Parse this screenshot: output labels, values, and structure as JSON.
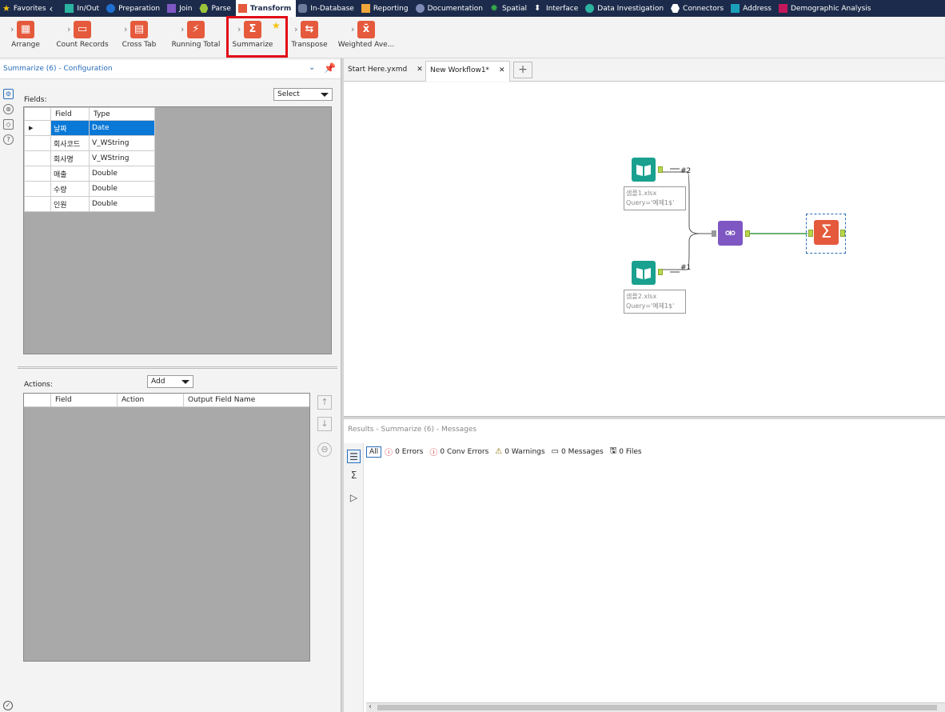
{
  "categories": [
    {
      "label": "Favorites",
      "icon": "star-icon",
      "color": "#f4c20d"
    },
    {
      "label": "In/Out",
      "icon": "folder-icon",
      "color": "#2bb3a0"
    },
    {
      "label": "Preparation",
      "icon": "circle-icon",
      "color": "#1f6fd1"
    },
    {
      "label": "Join",
      "icon": "square-icon",
      "color": "#7e57c2"
    },
    {
      "label": "Parse",
      "icon": "hexagon-icon",
      "color": "#9bc43a"
    },
    {
      "label": "Transform",
      "icon": "transform-icon",
      "color": "#e55a3c",
      "active": true
    },
    {
      "label": "In-Database",
      "icon": "database-icon",
      "color": "#6c7a9b"
    },
    {
      "label": "Reporting",
      "icon": "report-icon",
      "color": "#f0a63a"
    },
    {
      "label": "Documentation",
      "icon": "comment-icon",
      "color": "#7d8cb5"
    },
    {
      "label": "Spatial",
      "icon": "gear-icon",
      "color": "#35a84a"
    },
    {
      "label": "Interface",
      "icon": "updown-icon",
      "color": "#ffffff"
    },
    {
      "label": "Data Investigation",
      "icon": "search-icon",
      "color": "#2bb3a0"
    },
    {
      "label": "Connectors",
      "icon": "connector-icon",
      "color": "#ffffff"
    },
    {
      "label": "Address",
      "icon": "address-icon",
      "color": "#1aa0b8"
    },
    {
      "label": "Demographic Analysis",
      "icon": "demographic-icon",
      "color": "#c2185b"
    }
  ],
  "tools": [
    {
      "label": "Arrange",
      "glyph": "▦"
    },
    {
      "label": "Count Records",
      "glyph": "▭"
    },
    {
      "label": "Cross Tab",
      "glyph": "▤"
    },
    {
      "label": "Running Total",
      "glyph": "⚡"
    },
    {
      "label": "Summarize",
      "glyph": "Σ"
    },
    {
      "label": "Transpose",
      "glyph": "⇆"
    },
    {
      "label": "Weighted Ave...",
      "glyph": "x̄"
    }
  ],
  "config": {
    "title": "Summarize (6) - Configuration",
    "fields_label": "Fields:",
    "select_label": "Select",
    "fields_columns": [
      "Field",
      "Type"
    ],
    "fields": [
      {
        "field": "날짜",
        "type": "Date",
        "selected": true
      },
      {
        "field": "회사코드",
        "type": "V_WString"
      },
      {
        "field": "회사명",
        "type": "V_WString"
      },
      {
        "field": "매출",
        "type": "Double"
      },
      {
        "field": "수량",
        "type": "Double"
      },
      {
        "field": "인원",
        "type": "Double"
      }
    ],
    "actions_label": "Actions:",
    "add_label": "Add",
    "actions_columns": [
      "Field",
      "Action",
      "Output Field Name"
    ]
  },
  "tabs": [
    {
      "label": "Start Here.yxmd"
    },
    {
      "label": "New Workflow1*",
      "active": true
    }
  ],
  "workflow": {
    "input1": {
      "file": "샘플1.xlsx",
      "query": "Query='예제1$'",
      "tag": "#2"
    },
    "input2": {
      "file": "샘플2.xlsx",
      "query": "Query='예제1$'",
      "tag": "#1"
    }
  },
  "results": {
    "title": "Results - Summarize (6) - Messages",
    "all_label": "All",
    "filters": [
      {
        "label": "0 Errors",
        "icon": "error-icon",
        "color": "#d32f2f"
      },
      {
        "label": "0 Conv Errors",
        "icon": "conv-error-icon",
        "color": "#d32f2f"
      },
      {
        "label": "0 Warnings",
        "icon": "warning-icon",
        "color": "#8a6d00"
      },
      {
        "label": "0 Messages",
        "icon": "message-icon",
        "color": "#333333"
      },
      {
        "label": "0 Files",
        "icon": "file-icon",
        "color": "#333333"
      }
    ]
  }
}
